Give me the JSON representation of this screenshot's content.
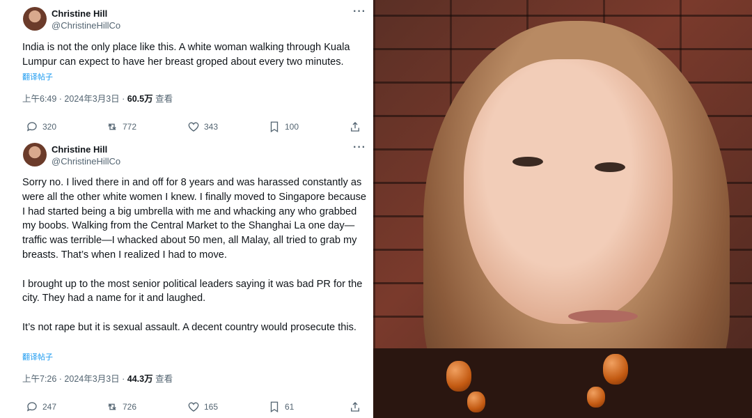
{
  "tweets": [
    {
      "name": "Christine Hill",
      "handle": "@ChristineHillCo",
      "more": "···",
      "text": "India is not the only place like this. A white woman walking through Kuala Lumpur can expect to have her breast groped about every two minutes.",
      "translate": "翻译帖子",
      "meta_time": "上午6:49 · 2024年3月3日 · ",
      "meta_views": "60.5万",
      "meta_suffix": " 查看",
      "replies": "320",
      "reposts": "772",
      "likes": "343",
      "bookmarks": "100"
    },
    {
      "name": "Christine Hill",
      "handle": "@ChristineHillCo",
      "more": "···",
      "text": "Sorry no. I lived there in and off for 8 years and was harassed constantly as were all the other white women I knew. I finally moved to Singapore because I had started being a big umbrella with me and whacking any who grabbed my boobs. Walking from the Central Market to the Shanghai La one day—traffic was terrible—I whacked about 50 men, all Malay, all tried to grab my breasts. That’s when I realized I had to move.\n\nI brought up to the most senior political leaders saying it was bad PR for the city. They had a name for it and laughed.\n\nIt’s not rape but it is sexual assault. A decent country would prosecute this.",
      "translate": "翻译帖子",
      "meta_time": "上午7:26 · 2024年3月3日 · ",
      "meta_views": "44.3万",
      "meta_suffix": " 查看",
      "replies": "247",
      "reposts": "726",
      "likes": "165",
      "bookmarks": "61"
    }
  ],
  "icons": {
    "reply": "reply-icon",
    "repost": "repost-icon",
    "like": "heart-icon",
    "bookmark": "bookmark-icon",
    "share": "share-icon"
  },
  "colors": {
    "link": "#1d9bf0",
    "secondary_text": "#536471",
    "primary_text": "#0f1419"
  }
}
